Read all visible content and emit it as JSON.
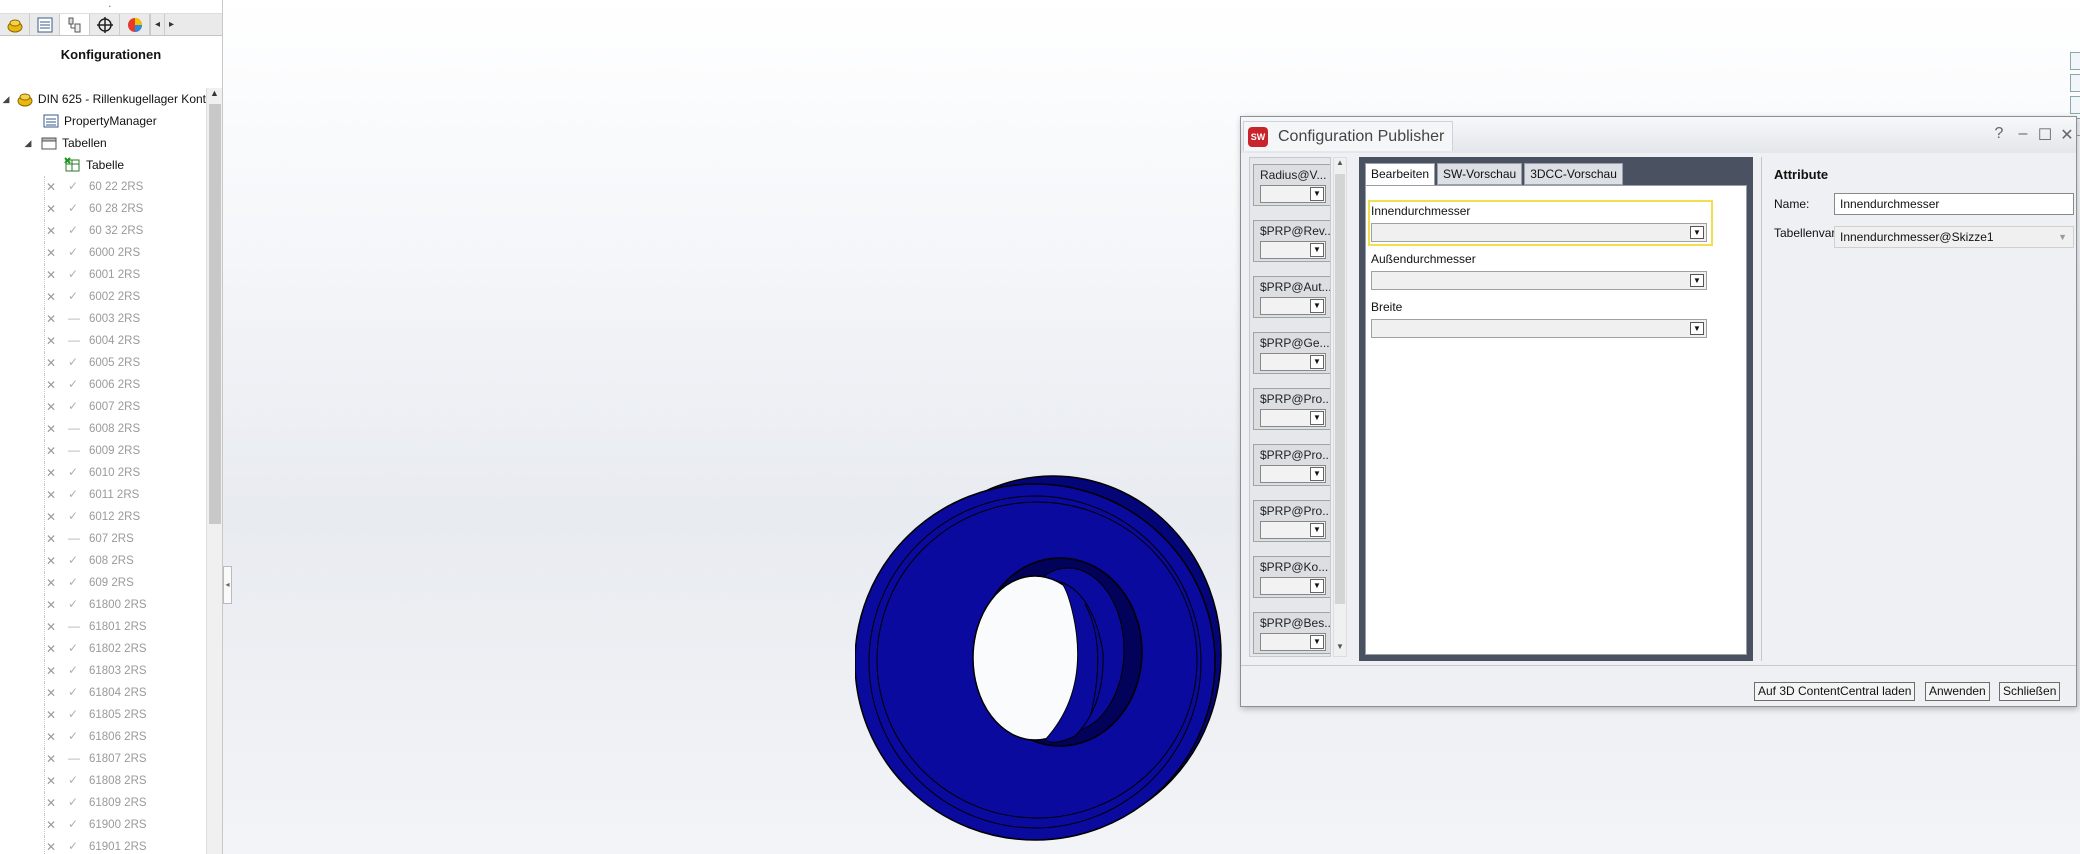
{
  "left_panel": {
    "grip": "⠂",
    "title": "Konfigurationen",
    "tree_top": [
      {
        "label": "DIN 625 - Rillenkugellager Kont",
        "icon": "part-icon"
      },
      {
        "label": "PropertyManager",
        "icon": "property-manager-icon"
      },
      {
        "label": "Tabellen",
        "icon": "tables-folder-icon"
      },
      {
        "label": "Tabelle",
        "icon": "design-table-icon"
      }
    ],
    "configurations": [
      "60 22 2RS",
      "60 28 2RS",
      "60 32 2RS",
      "6000 2RS",
      "6001 2RS",
      "6002 2RS",
      "6003 2RS",
      "6004 2RS",
      "6005 2RS",
      "6006 2RS",
      "6007 2RS",
      "6008 2RS",
      "6009 2RS",
      "6010 2RS",
      "6011 2RS",
      "6012 2RS",
      "607 2RS",
      "608 2RS",
      "609 2RS",
      "61800 2RS",
      "61801 2RS",
      "61802 2RS",
      "61803 2RS",
      "61804 2RS",
      "61805 2RS",
      "61806 2RS",
      "61807 2RS",
      "61808 2RS",
      "61809 2RS",
      "61900 2RS",
      "61901 2RS"
    ]
  },
  "dialog": {
    "title": "Configuration Publisher",
    "logo_text": "SW",
    "controls": {
      "help": "?",
      "minimize": "–",
      "maximize": "☐",
      "close": "✕"
    },
    "params": [
      "Radius@V...",
      "$PRP@Rev...",
      "$PRP@Aut...",
      "$PRP@Ge...",
      "$PRP@Pro...",
      "$PRP@Pro...",
      "$PRP@Pro...",
      "$PRP@Ko...",
      "$PRP@Bes..."
    ],
    "tabs": [
      "Bearbeiten",
      "SW-Vorschau",
      "3DCC-Vorschau"
    ],
    "fields": [
      {
        "label": "Innendurchmesser",
        "value": ""
      },
      {
        "label": "Außendurchmesser",
        "value": ""
      },
      {
        "label": "Breite",
        "value": ""
      }
    ],
    "attributes": {
      "title": "Attribute",
      "name_label": "Name:",
      "name_value": "Innendurchmesser",
      "table_var_label": "Tabellenvariable:",
      "table_var_value": "Innendurchmesser@Skizze1"
    },
    "buttons": {
      "upload": "Auf 3D ContentCentral laden",
      "apply": "Anwenden",
      "close": "Schließen"
    }
  },
  "colors": {
    "model_fill": "#0a0a9e",
    "highlight": "#f0e050",
    "dialog_center_bg": "#4a5262"
  }
}
